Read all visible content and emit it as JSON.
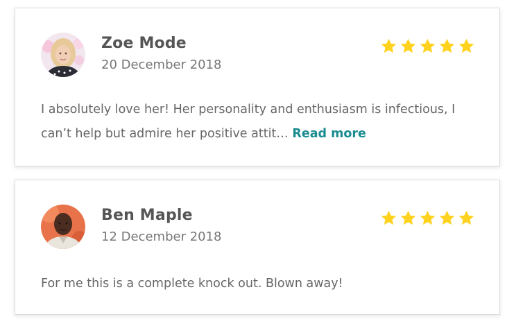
{
  "colors": {
    "star": "#FFD21F",
    "link": "#1A8C8F",
    "name_text": "#555555",
    "body_text": "#666666",
    "card_border": "#DCDCDC"
  },
  "reviews": [
    {
      "name": "Zoe Mode",
      "date": "20 December 2018",
      "rating": 5,
      "text": "I absolutely love her! Her personality and enthusiasm is infectious, I can’t help but admire her positive attit…",
      "read_more": "Read more",
      "avatar_icon": "user-photo-woman"
    },
    {
      "name": "Ben Maple",
      "date": "12 December 2018",
      "rating": 5,
      "text": "For me this is a complete knock out. Blown away!",
      "avatar_icon": "user-photo-man"
    }
  ]
}
